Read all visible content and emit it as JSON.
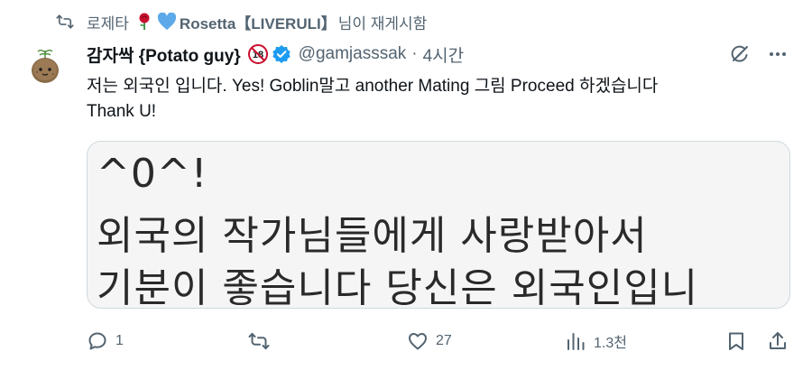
{
  "repost": {
    "icon": "repost-icon",
    "user_prefix": "로제타",
    "user_name": "Rosetta【LIVERULI】",
    "suffix": "님이 재게시함"
  },
  "tweet": {
    "display_name": "감자싹 {Potato guy}",
    "handle": "@gamjasssak",
    "separator": "·",
    "time": "4시간",
    "text_line1": "저는 외국인 입니다. Yes! Goblin말고 another Mating 그림 Proceed 하겠습니다",
    "text_line2": "Thank U!",
    "age_badge": "18"
  },
  "media": {
    "line1": "^0^!",
    "line2": "외국의 작가님들에게 사랑받아서",
    "line3": "기분이 좋습니다 당신은 외국인입니"
  },
  "actions": {
    "replies": "1",
    "reposts": "",
    "likes": "27",
    "views": "1.3천"
  },
  "colors": {
    "text": "#0f1419",
    "muted": "#536471",
    "verified": "#1d9bf0",
    "border": "#cfd9de",
    "age_badge": "#c8102e"
  }
}
